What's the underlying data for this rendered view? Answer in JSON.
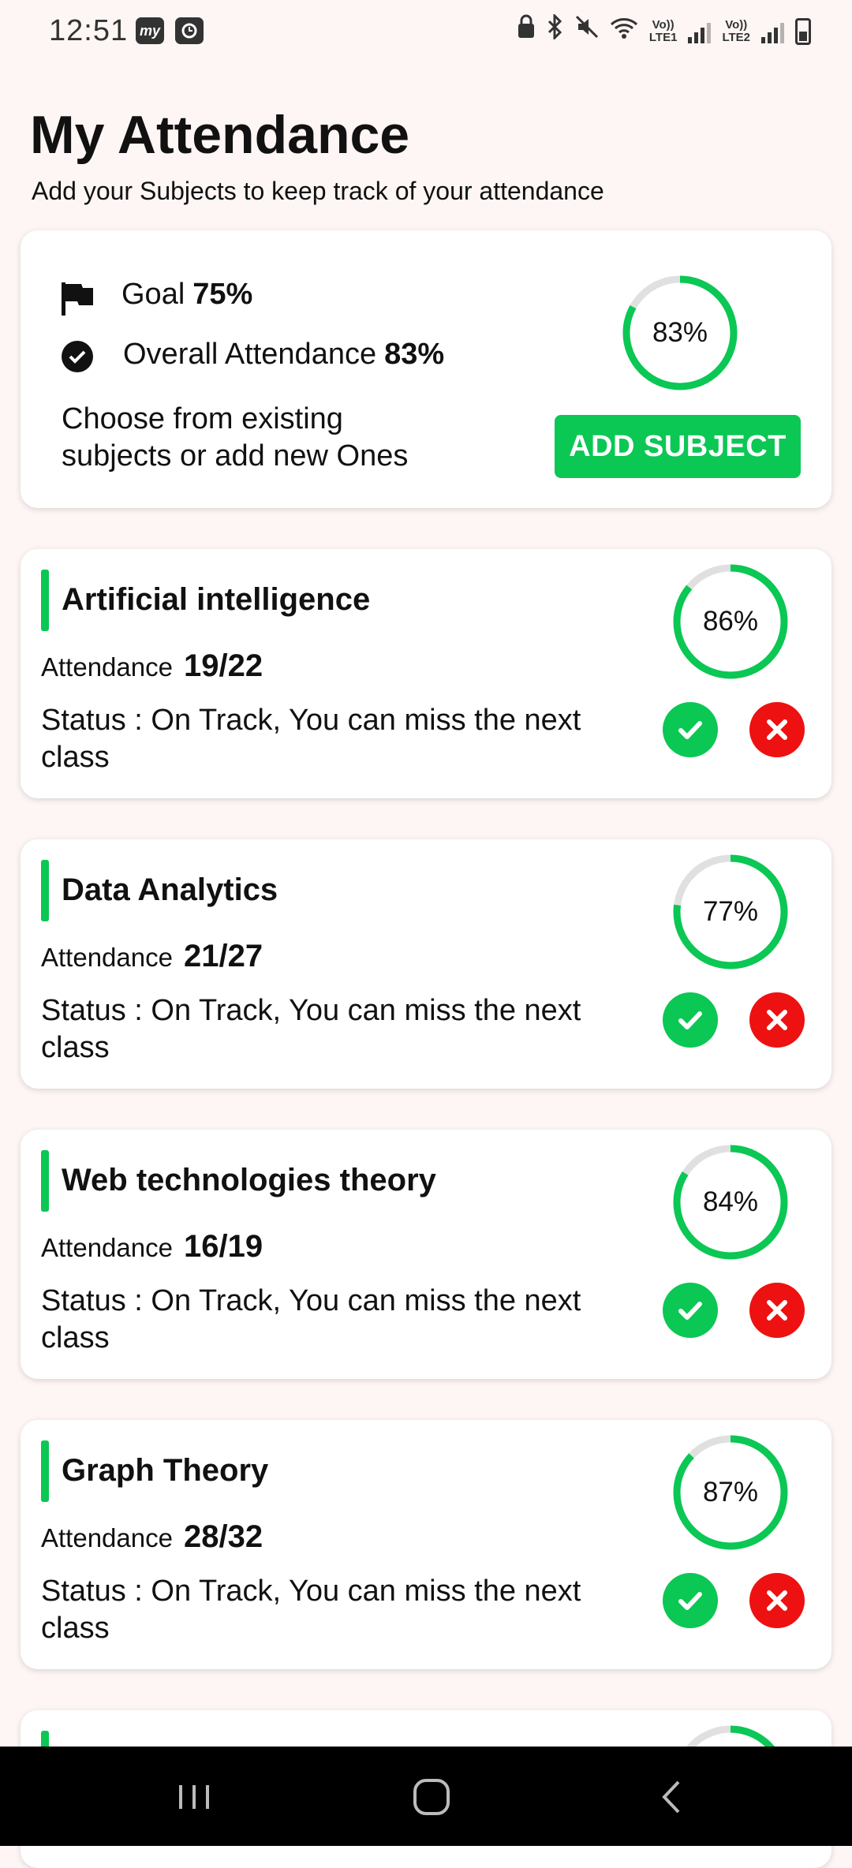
{
  "status_bar": {
    "time": "12:51",
    "left_icons": [
      "my-app-icon",
      "clock-app-icon"
    ],
    "right_icons": [
      "lock-icon",
      "bluetooth-icon",
      "mute-icon",
      "wifi-icon",
      "signal-lte1",
      "signal-lte2",
      "battery-icon"
    ],
    "lte1_top": "Vo))",
    "lte1_bottom": "LTE1",
    "lte2_top": "Vo))",
    "lte2_bottom": "LTE2"
  },
  "header": {
    "title": "My Attendance",
    "subtitle": "Add your Subjects to keep track of your attendance"
  },
  "summary": {
    "goal_label": "Goal",
    "goal_value": "75%",
    "overall_label": "Overall Attendance",
    "overall_value": "83%",
    "overall_fraction": 0.83,
    "choose_text": "Choose from existing subjects or add new Ones",
    "add_button": "ADD SUBJECT"
  },
  "subjects": [
    {
      "name": "Artificial intelligence",
      "attendance_label": "Attendance",
      "attendance": "19/22",
      "percent_text": "86%",
      "fraction": 0.86,
      "status": "Status : On Track, You can miss the next class"
    },
    {
      "name": "Data Analytics",
      "attendance_label": "Attendance",
      "attendance": "21/27",
      "percent_text": "77%",
      "fraction": 0.77,
      "status": "Status : On Track, You can miss the next class"
    },
    {
      "name": "Web technologies theory",
      "attendance_label": "Attendance",
      "attendance": "16/19",
      "percent_text": "84%",
      "fraction": 0.84,
      "status": "Status : On Track, You can miss the next class"
    },
    {
      "name": "Graph Theory",
      "attendance_label": "Attendance",
      "attendance": "28/32",
      "percent_text": "87%",
      "fraction": 0.87,
      "status": "Status : On Track, You can miss the next class"
    }
  ],
  "colors": {
    "accent": "#0bc754",
    "absent": "#ee1111",
    "ring_track": "#e0e0e0",
    "background": "#fdf6f4"
  },
  "nav": {
    "icons": [
      "recent-apps-icon",
      "home-icon",
      "back-icon"
    ]
  }
}
